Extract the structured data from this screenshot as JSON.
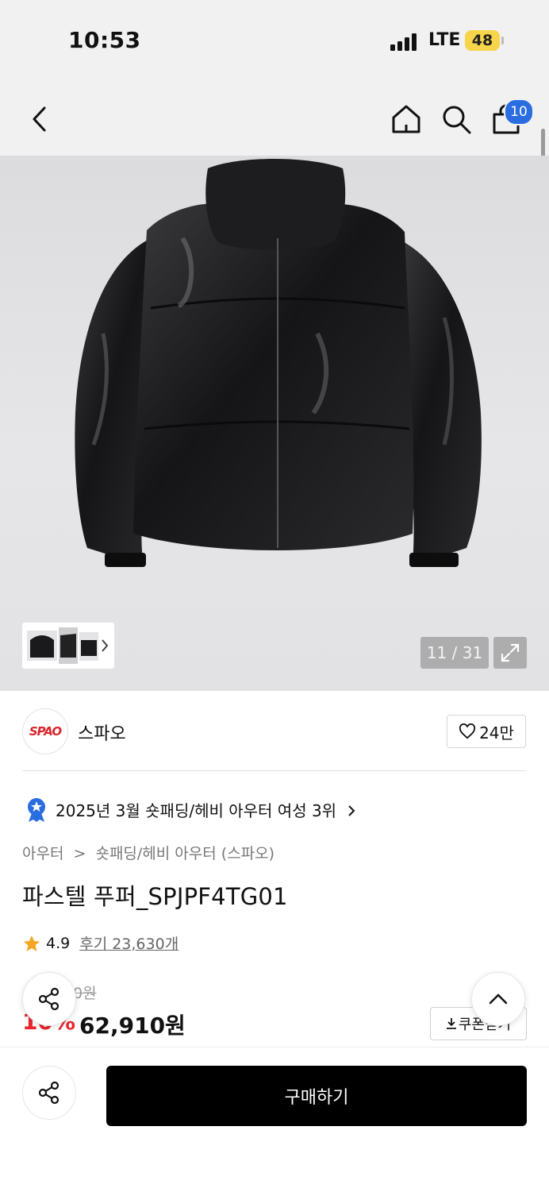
{
  "status_bar": {
    "time": "10:53",
    "network": "LTE",
    "battery": "48"
  },
  "nav": {
    "back_icon": "chevron-left-icon",
    "home_icon": "home-icon",
    "search_icon": "search-icon",
    "cart_icon": "shopping-bag-icon",
    "cart_count": "10"
  },
  "gallery": {
    "counter": "11 / 31",
    "expand_icon": "expand-icon",
    "thumb_arrow": "chevron-right-icon"
  },
  "brand": {
    "logo_text": "SPAO",
    "name": "스파오",
    "likes": "24만"
  },
  "ranking": {
    "text": "2025년 3월 숏패딩/헤비 아우터 여성 3위"
  },
  "breadcrumb": {
    "category": "아우터",
    "separator": ">",
    "subcategory": "숏패딩/헤비 아우터 (스파오)"
  },
  "product": {
    "name": "파스텔 푸퍼_SPJPF4TG01",
    "rating": "4.9",
    "reviews": "후기 23,630개",
    "original_price": "0원",
    "discount": "10%",
    "price": "62,910원",
    "coupon_label": "쿠폰받기"
  },
  "actions": {
    "buy_label": "구매하기",
    "share_icon": "share-icon",
    "scroll_top_icon": "chevron-up-icon"
  },
  "colors": {
    "accent_blue": "#2a6de0",
    "sale_red": "#e8262f",
    "buy_black": "#000000"
  }
}
